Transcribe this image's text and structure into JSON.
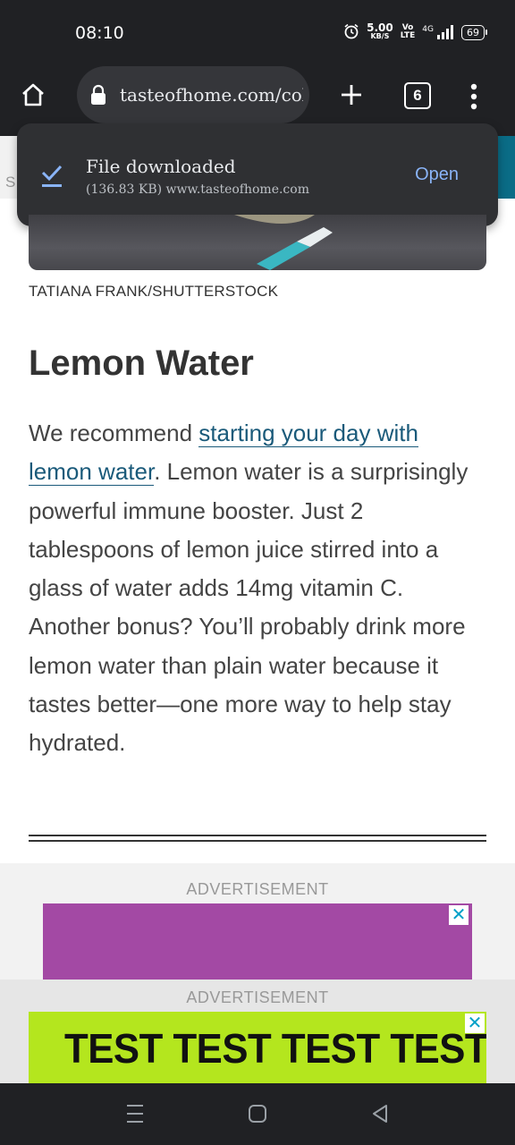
{
  "status_bar": {
    "time": "08:10",
    "net_speed": "5.00",
    "net_unit": "KB/S",
    "volte_top": "Vo",
    "volte_bottom": "LTE",
    "network": "4G",
    "battery": "69"
  },
  "browser": {
    "url": "tasteofhome.com/col",
    "tab_count": "6"
  },
  "download_toast": {
    "title": "File downloaded",
    "details": "(136.83 KB) www.tasteofhome.com",
    "action": "Open"
  },
  "page_edge_letter": "S",
  "article": {
    "photo_credit": "TATIANA FRANK/SHUTTERSTOCK",
    "heading": "Lemon Water",
    "body_intro": "We recommend ",
    "body_link": "starting your day with lemon water",
    "body_rest": ". Lemon water is a surprisingly powerful immune booster. Just 2 tablespoons of lemon juice stirred into a glass of water adds 14mg vitamin C. Another bonus? You’ll probably drink more lemon water than plain water because it tastes better—one more way to help stay hydrated."
  },
  "ads": {
    "label_1": "ADVERTISEMENT",
    "label_2": "ADVERTISEMENT",
    "banner_text": "TEST TEST TEST TEST"
  },
  "colors": {
    "ad1_background": "#a349a4",
    "ad2_background": "#b4e61e",
    "link": "#1a5a7a",
    "toast_action": "#8ab4f8"
  },
  "icons": {
    "home": "home-icon",
    "lock": "lock-icon",
    "new_tab": "plus-icon",
    "tabs": "tab-switcher-icon",
    "menu": "more-vert-icon",
    "download_done": "download-done-icon",
    "ad_close": "close-icon",
    "nav_recents": "recents-icon",
    "nav_home": "nav-home-icon",
    "nav_back": "back-icon"
  }
}
